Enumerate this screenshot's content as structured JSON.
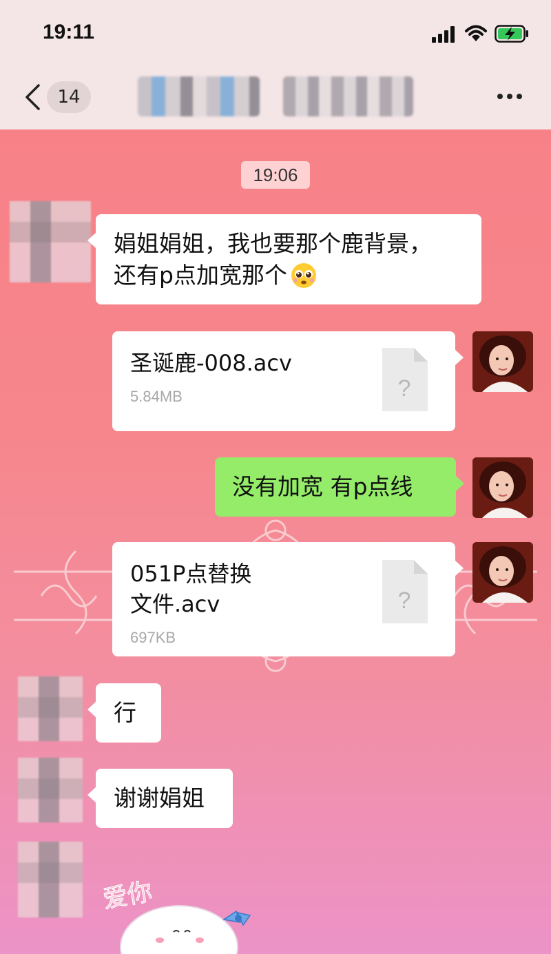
{
  "status_bar": {
    "time": "19:11",
    "icons": [
      "signal-icon",
      "wifi-icon",
      "battery-charging-icon"
    ]
  },
  "nav": {
    "back_icon": "chevron-left-icon",
    "unread_count": "14",
    "title": "",
    "more_icon": "more-dots-icon"
  },
  "chat": {
    "timestamp": "19:06",
    "messages": [
      {
        "side": "left",
        "type": "text",
        "lines": [
          "娟姐娟姐，我也要那个鹿背景，",
          "还有p点加宽那个"
        ],
        "emoji": "pleading-face-emoji"
      },
      {
        "side": "right",
        "type": "file",
        "name_lines": [
          "圣诞鹿-008.acv"
        ],
        "size": "5.84MB",
        "file_icon": "unknown-file-icon",
        "file_icon_glyph": "?"
      },
      {
        "side": "right",
        "type": "text",
        "text": "没有加宽 有p点线",
        "bubble_color": "#95ec69"
      },
      {
        "side": "right",
        "type": "file",
        "name_lines": [
          "051P点替换",
          "文件.acv"
        ],
        "size": "697KB",
        "file_icon": "unknown-file-icon",
        "file_icon_glyph": "?"
      },
      {
        "side": "left",
        "type": "text",
        "text": "行"
      },
      {
        "side": "left",
        "type": "text",
        "text": "谢谢娟姐"
      },
      {
        "side": "left",
        "type": "sticker",
        "sticker_text": "爱你"
      }
    ]
  },
  "colors": {
    "top_bar": "#f4e5e6",
    "chat_background_top": "#f87f86",
    "chat_background_bottom": "#ec93c7",
    "own_bubble": "#95ec69",
    "other_bubble": "#ffffff"
  }
}
